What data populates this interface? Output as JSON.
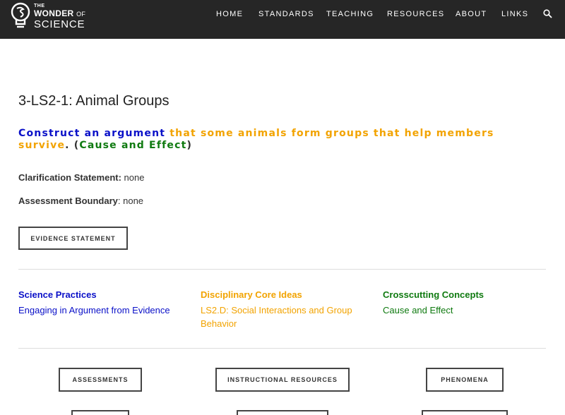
{
  "header": {
    "logo": {
      "the": "THE",
      "wonder": "WONDER",
      "of": "OF",
      "science": "SCIENCE"
    },
    "nav": [
      {
        "label": "HOME"
      },
      {
        "label": "STANDARDS"
      },
      {
        "label": "TEACHING"
      },
      {
        "label": "RESOURCES"
      },
      {
        "label": "ABOUT"
      },
      {
        "label": "LINKS"
      }
    ],
    "search_icon": "search-icon"
  },
  "main": {
    "title": "3-LS2-1: Animal Groups",
    "performance_expectation": {
      "practice": "Construct an argument",
      "core_idea": "that some animals form groups that help members survive",
      "period": ". (",
      "concept": "Cause and Effect",
      "close": ")"
    },
    "clarification": {
      "label": "Clarification Statement:",
      "value": " none"
    },
    "assessment_boundary": {
      "label": "Assessment Boundary",
      "value": ": none"
    },
    "evidence_button": "EVIDENCE STATEMENT",
    "dimensions": [
      {
        "heading": "Science Practices",
        "link": "Engaging in Argument from Evidence",
        "color": "#0a10c8"
      },
      {
        "heading": "Disciplinary Core Ideas",
        "link": "LS2.D: Social Interactions and Group Behavior",
        "color": "#f2a300"
      },
      {
        "heading": "Crosscutting Concepts",
        "link": "Cause and Effect",
        "color": "#0f7a10"
      }
    ],
    "resource_buttons": [
      {
        "label": "ASSESSMENTS"
      },
      {
        "label": "INSTRUCTIONAL RESOURCES"
      },
      {
        "label": "PHENOMENA"
      }
    ]
  },
  "colors": {
    "header_bg": "#262626",
    "practice_blue": "#0a10c8",
    "core_orange": "#f2a300",
    "concept_green": "#0f7a10"
  }
}
